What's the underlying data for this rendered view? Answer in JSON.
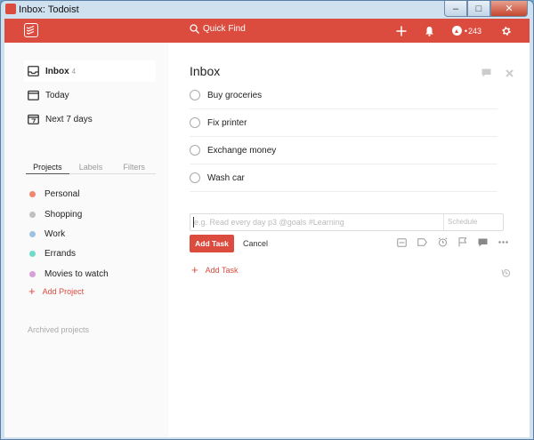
{
  "window": {
    "title": "Inbox: Todoist",
    "minimize": "–",
    "maximize": "□",
    "close": "✕"
  },
  "topbar": {
    "search_label": "Quick Find",
    "karma_count": "243",
    "karma_prefix": "•",
    "accent": "#db4c3f"
  },
  "sidebar": {
    "nav": [
      {
        "label": "Inbox",
        "count": "4",
        "icon": "inbox-icon"
      },
      {
        "label": "Today",
        "icon": "calendar-icon"
      },
      {
        "label": "Next 7 days",
        "icon": "calendar-week-icon"
      }
    ],
    "tabs": [
      "Projects",
      "Labels",
      "Filters"
    ],
    "projects": [
      {
        "label": "Personal",
        "color": "#f0886f"
      },
      {
        "label": "Shopping",
        "color": "#c0c0c0"
      },
      {
        "label": "Work",
        "color": "#a0c0e0"
      },
      {
        "label": "Errands",
        "color": "#6fdcc8"
      },
      {
        "label": "Movies to watch",
        "color": "#d8a0d8"
      }
    ],
    "add_project": "Add Project",
    "archived": "Archived projects"
  },
  "main": {
    "title": "Inbox",
    "tasks": [
      "Buy groceries",
      "Fix printer",
      "Exchange money",
      "Wash car"
    ],
    "editor": {
      "placeholder": "e.g. Read every day p3 @goals #Learning",
      "value": "",
      "schedule": "Schedule"
    },
    "add_task_button": "Add Task",
    "cancel": "Cancel",
    "add_task_link": "Add Task"
  }
}
